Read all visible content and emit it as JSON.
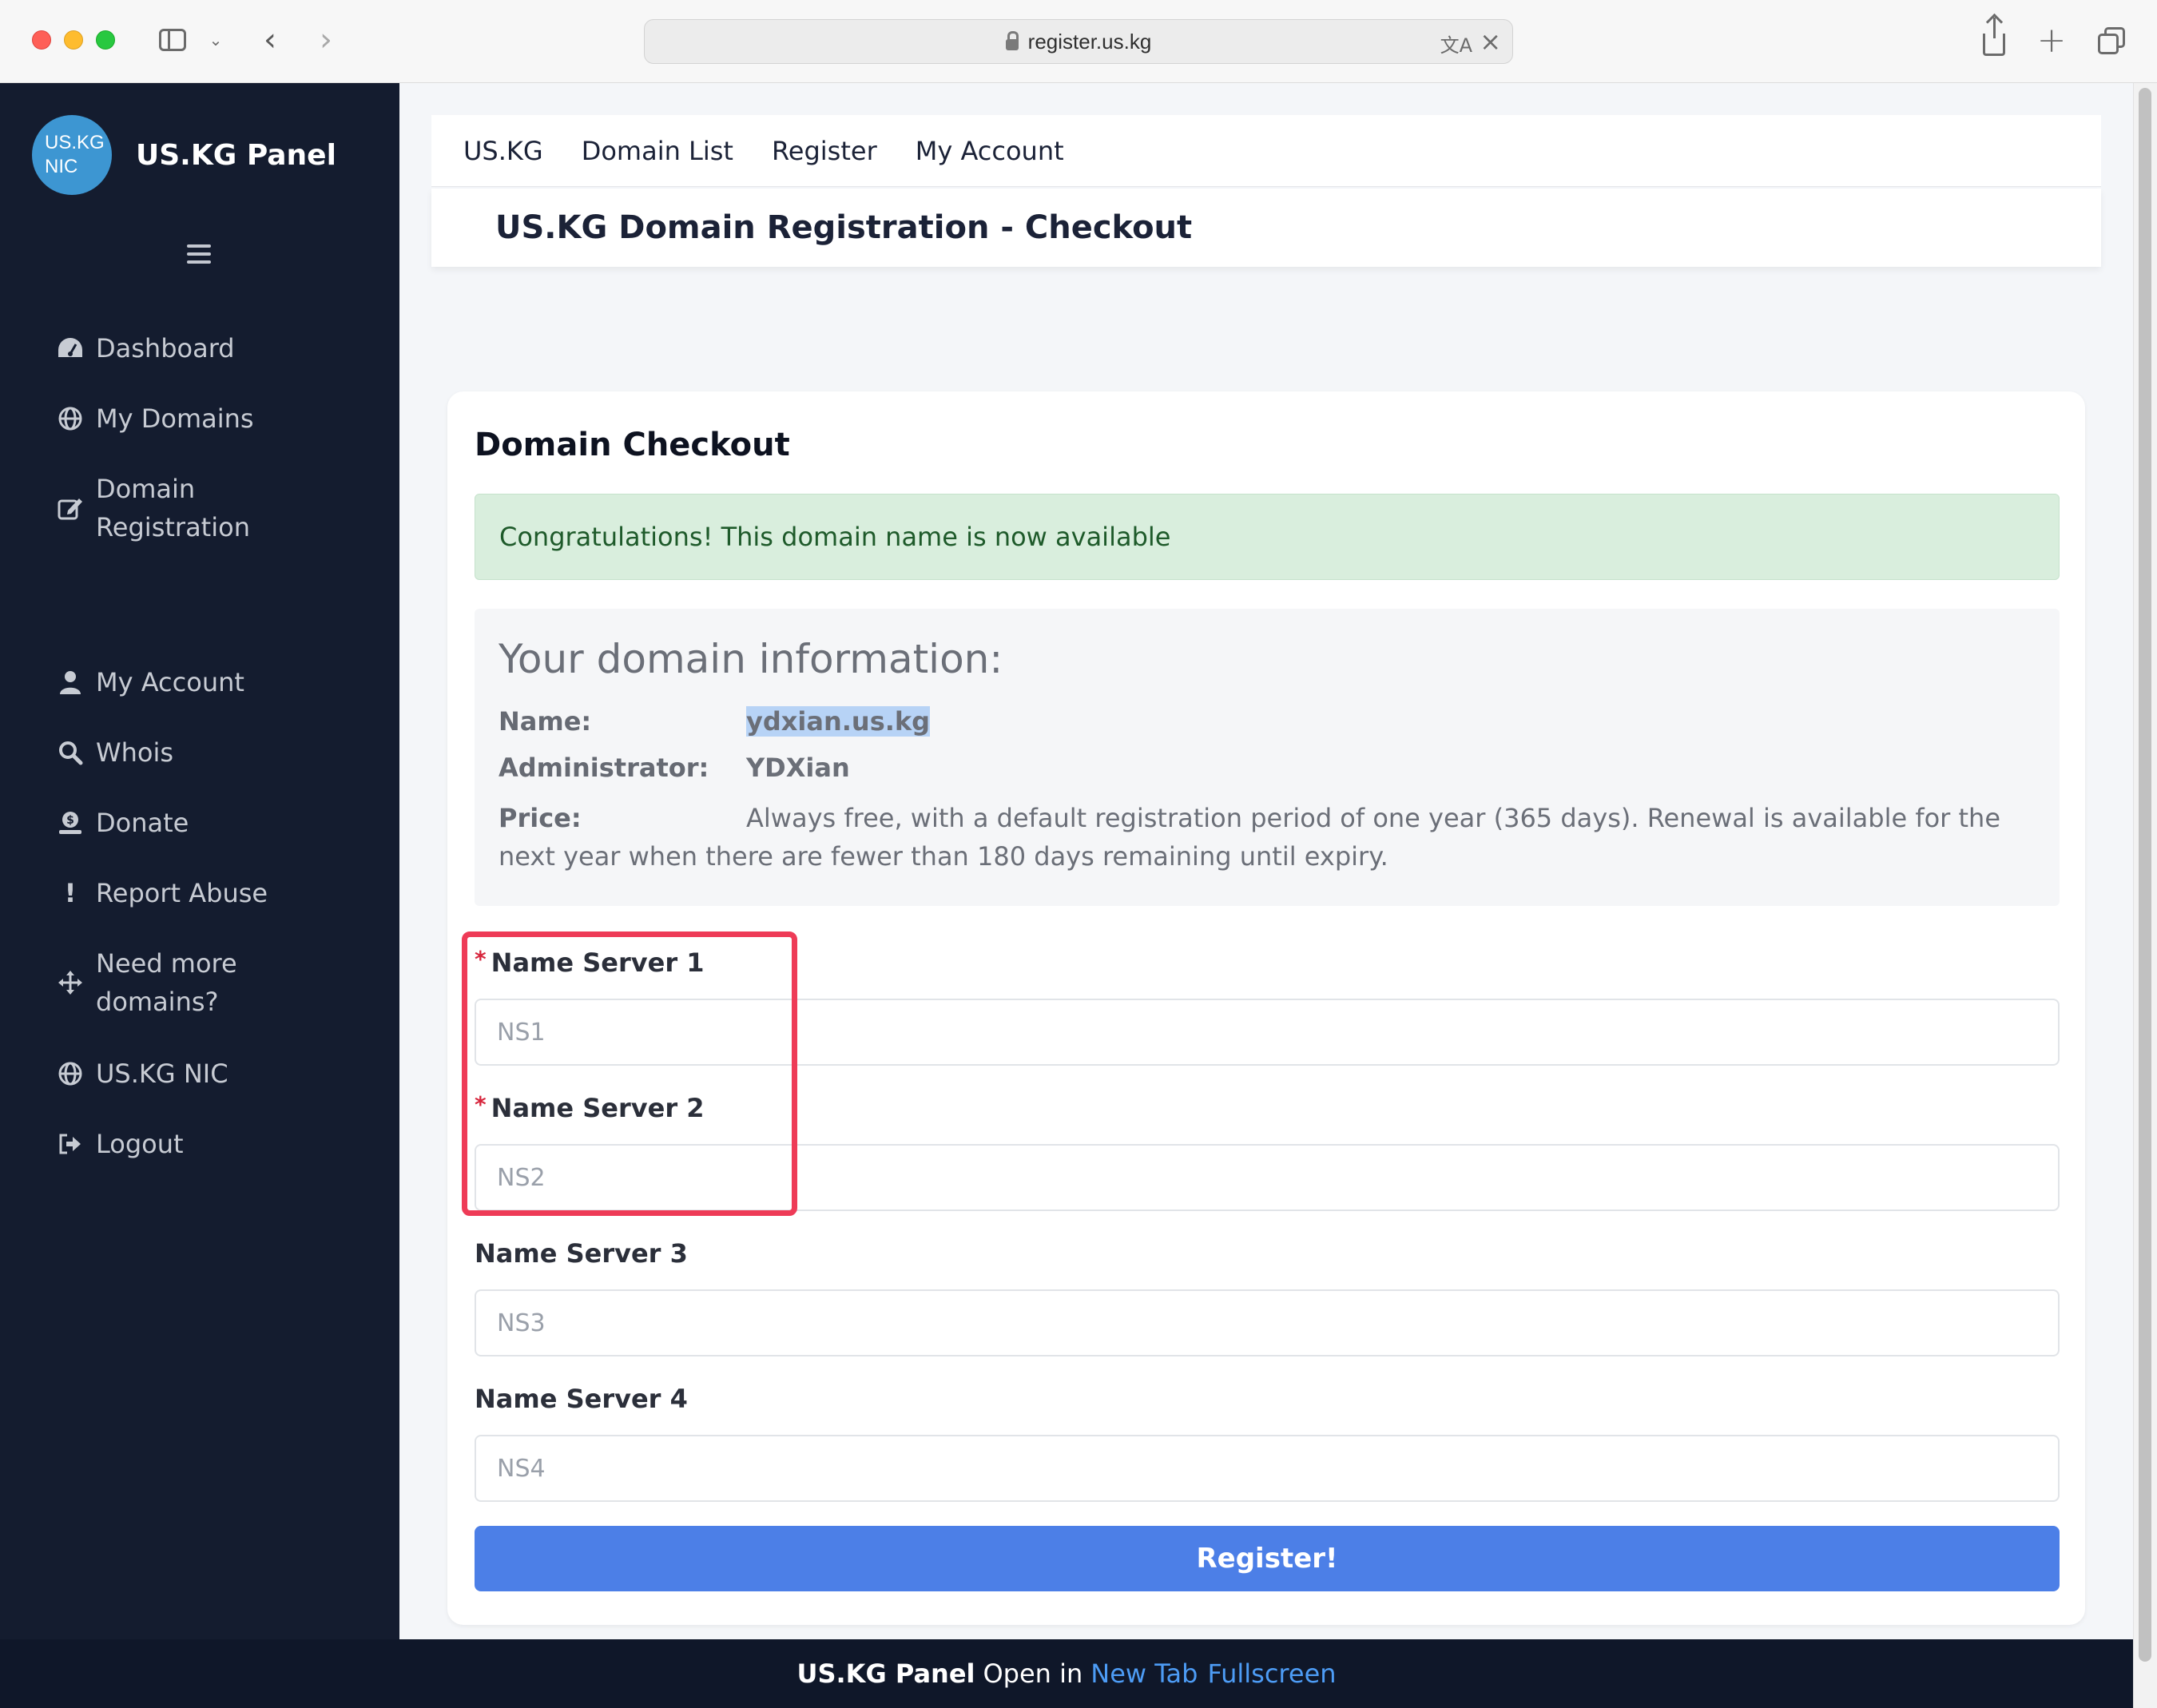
{
  "browser": {
    "url": "register.us.kg"
  },
  "sidebar": {
    "logo_text_line1": "US.KG",
    "logo_text_line2": "NIC",
    "brand_title": "US.KG Panel",
    "items": [
      {
        "label": "Dashboard",
        "icon": "dashboard-icon"
      },
      {
        "label": "My Domains",
        "icon": "globe-icon"
      },
      {
        "label": "Domain Registration",
        "icon": "edit-icon"
      },
      {
        "label": "My Account",
        "icon": "user-icon"
      },
      {
        "label": "Whois",
        "icon": "search-icon"
      },
      {
        "label": "Donate",
        "icon": "donate-icon"
      },
      {
        "label": "Report Abuse",
        "icon": "exclamation-icon"
      },
      {
        "label": "Need more domains?",
        "icon": "move-icon"
      },
      {
        "label": "US.KG NIC",
        "icon": "globe-icon"
      },
      {
        "label": "Logout",
        "icon": "logout-icon"
      }
    ]
  },
  "topnav": {
    "items": [
      "US.KG",
      "Domain List",
      "Register",
      "My Account"
    ]
  },
  "page": {
    "heading": "US.KG Domain Registration - Checkout"
  },
  "card": {
    "title": "Domain Checkout",
    "alert": "Congratulations! This domain name is now available",
    "info": {
      "title": "Your domain information:",
      "name_label": "Name:",
      "name_value": "ydxian.us.kg",
      "admin_label": "Administrator:",
      "admin_value": "YDXian",
      "price_label": "Price:",
      "price_value": "Always free, with a default registration period of one year (365 days). Renewal is available for the next year when there are fewer than 180 days remaining until expiry."
    },
    "fields": [
      {
        "label": "Name Server 1",
        "placeholder": "NS1",
        "required": "*"
      },
      {
        "label": "Name Server 2",
        "placeholder": "NS2",
        "required": "*"
      },
      {
        "label": "Name Server 3",
        "placeholder": "NS3"
      },
      {
        "label": "Name Server 4",
        "placeholder": "NS4"
      }
    ],
    "submit_label": "Register!"
  },
  "footer": {
    "brand": "US.KG Panel",
    "text": "Open in",
    "link1": "New Tab",
    "link2": "Fullscreen"
  },
  "colors": {
    "sidebar_bg": "#141c2f",
    "accent_button": "#4c7fe7",
    "alert_bg": "#d9eedd",
    "highlight": "#ee3b57",
    "link": "#4d9cf5"
  }
}
